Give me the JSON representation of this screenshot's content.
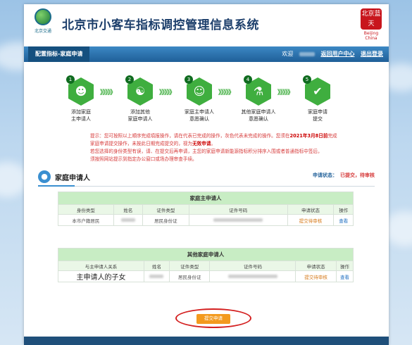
{
  "header": {
    "logo_text": "北京交通",
    "system_title": "北京市小客车指标调控管理信息系统",
    "brand_seal": "北京蓝天",
    "brand_en": "Beijing China"
  },
  "nav": {
    "tab_label": "配置指标-家庭申请",
    "welcome": "欢迎",
    "return_link": "返回用户中心",
    "logout_link": "退出登录"
  },
  "steps": [
    {
      "num": "1",
      "label_line1": "添加家庭",
      "label_line2": "主申请人",
      "icon": "add-user-icon"
    },
    {
      "num": "2",
      "label_line1": "添加其他",
      "label_line2": "家庭申请人",
      "icon": "add-users-icon"
    },
    {
      "num": "3",
      "label_line1": "家庭主申请人",
      "label_line2": "意愿确认",
      "icon": "confirm-user-icon"
    },
    {
      "num": "4",
      "label_line1": "其他家庭申请人",
      "label_line2": "意愿确认",
      "icon": "group-confirm-icon"
    },
    {
      "num": "5",
      "label_line1": "家庭申请",
      "label_line2": "提交",
      "icon": "check-icon"
    }
  ],
  "arrows": "》》》》》",
  "notice": {
    "line1a": "提示：您可按照以上顺序完成填报操作，请在代表已完成的操作，灰色代表未完成的操作。您须在",
    "line1_date": "2021年3月8日前",
    "line1b": "完成",
    "line2a": "家庭申请提交操作，未按此日期完成提交的，视为",
    "line2_bold": "无效申请",
    "line2b": "。",
    "line3": "若您选择的身份类型有误，请、在提交后再申请，主您的家庭申请新能源指标积分排序入围或者普通指标中签后，",
    "line4": "须按照网站提示到指定办公窗口或场办理审查手续。"
  },
  "section": {
    "title": "家庭申请人",
    "status_label": "申请状态：",
    "status_value": "已提交，待审核"
  },
  "main_table": {
    "caption": "家庭主申请人",
    "headers": [
      "身份类型",
      "姓名",
      "证件类型",
      "证件号码",
      "申请状态",
      "操作"
    ],
    "row": {
      "identity": "本市户籍居民",
      "id_type": "居民身份证",
      "status": "提交待审核",
      "action": "查看"
    }
  },
  "other_table": {
    "caption": "其他家庭申请人",
    "headers": [
      "与主申请人关系",
      "姓名",
      "证件类型",
      "证件号码",
      "申请状态",
      "操作"
    ],
    "row": {
      "relation": "主申请人的子女",
      "id_type": "居民身份证",
      "status": "提交待审核",
      "action": "查看"
    }
  },
  "submit_label": "提交申请",
  "colors": {
    "accent_green": "#3fae3f",
    "nav_blue": "#1f5f98",
    "warning_red": "#d63a3a",
    "button_orange": "#f39a1e"
  }
}
